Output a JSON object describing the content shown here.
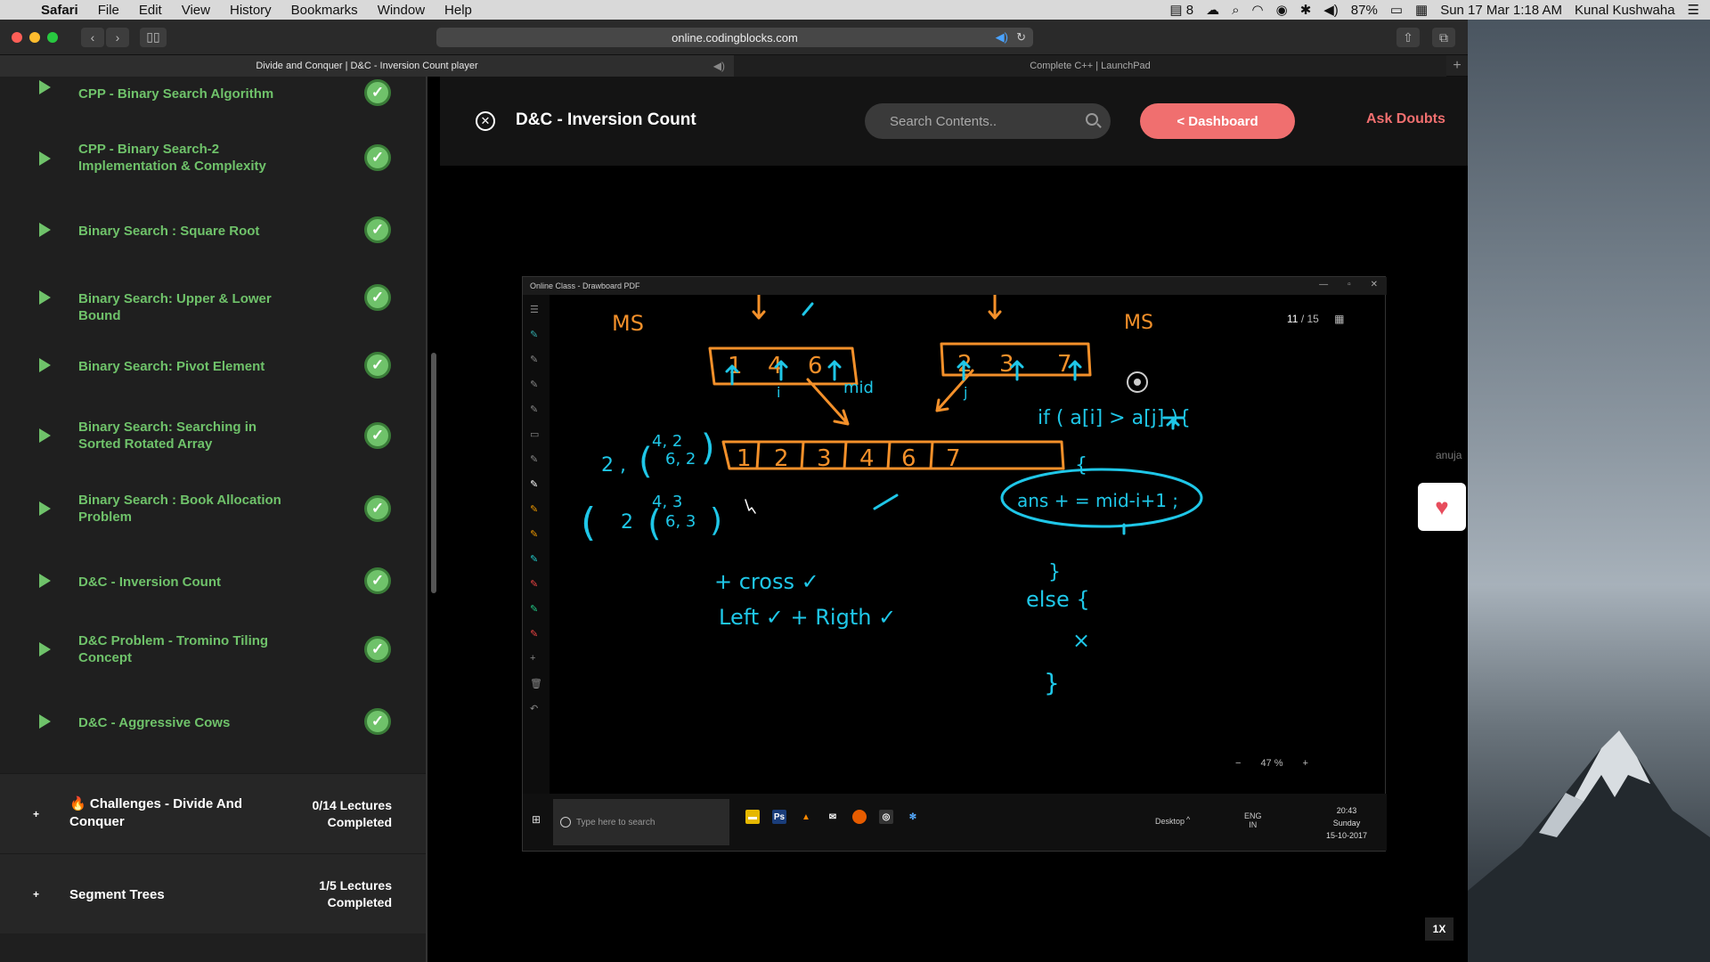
{
  "menubar": {
    "apple_icon": "apple-icon",
    "app": "Safari",
    "items": [
      "File",
      "Edit",
      "View",
      "History",
      "Bookmarks",
      "Window",
      "Help"
    ],
    "status": {
      "notes_count": "8",
      "battery": "87%",
      "datetime": "Sun 17 Mar  1:18 AM",
      "user": "Kunal Kushwaha"
    }
  },
  "browser": {
    "url": "online.codingblocks.com",
    "tabs": [
      {
        "title": "Divide and Conquer | D&C - Inversion Count player"
      },
      {
        "title": "Complete C++ | LaunchPad"
      }
    ]
  },
  "sidebar": {
    "lectures": [
      {
        "title": "CPP - Binary Search Algorithm"
      },
      {
        "title": "CPP - Binary Search-2 Implementation & Complexity"
      },
      {
        "title": "Binary Search : Square Root"
      },
      {
        "title": "Binary Search: Upper & Lower Bound"
      },
      {
        "title": "Binary Search: Pivot Element"
      },
      {
        "title": "Binary Search: Searching in Sorted Rotated Array"
      },
      {
        "title": "Binary Search : Book Allocation Problem"
      },
      {
        "title": "D&C - Inversion Count"
      },
      {
        "title": "D&C Problem - Tromino Tiling Concept"
      },
      {
        "title": "D&C - Aggressive Cows"
      }
    ],
    "sections": [
      {
        "emoji": "🔥",
        "title": "Challenges - Divide And Conquer",
        "progress": "0/14 Lectures Completed"
      },
      {
        "emoji": "",
        "title": "Segment Trees",
        "progress": "1/5 Lectures Completed"
      }
    ]
  },
  "header": {
    "title": "D&C - Inversion Count",
    "search_placeholder": "Search Contents..",
    "dashboard_label": "< Dashboard",
    "ask_label": "Ask Doubts"
  },
  "video": {
    "window_title": "Online Class - Drawboard PDF",
    "page_current": "11",
    "page_total": "/ 15",
    "zoom": "47 %",
    "taskbar_search": "Type here to search",
    "taskbar_desktop": "Desktop",
    "taskbar_lang": "ENG\nIN",
    "taskbar_time": "20:43",
    "taskbar_day": "Sunday",
    "taskbar_date": "15-10-2017"
  },
  "side_widget": {
    "user_fragment": "anuja"
  },
  "player": {
    "speed": "1X"
  },
  "colors": {
    "accent_green": "#6fc26a",
    "accent_red": "#f06f6f",
    "ink_cyan": "#1fc7e8",
    "ink_orange": "#f3902a"
  }
}
